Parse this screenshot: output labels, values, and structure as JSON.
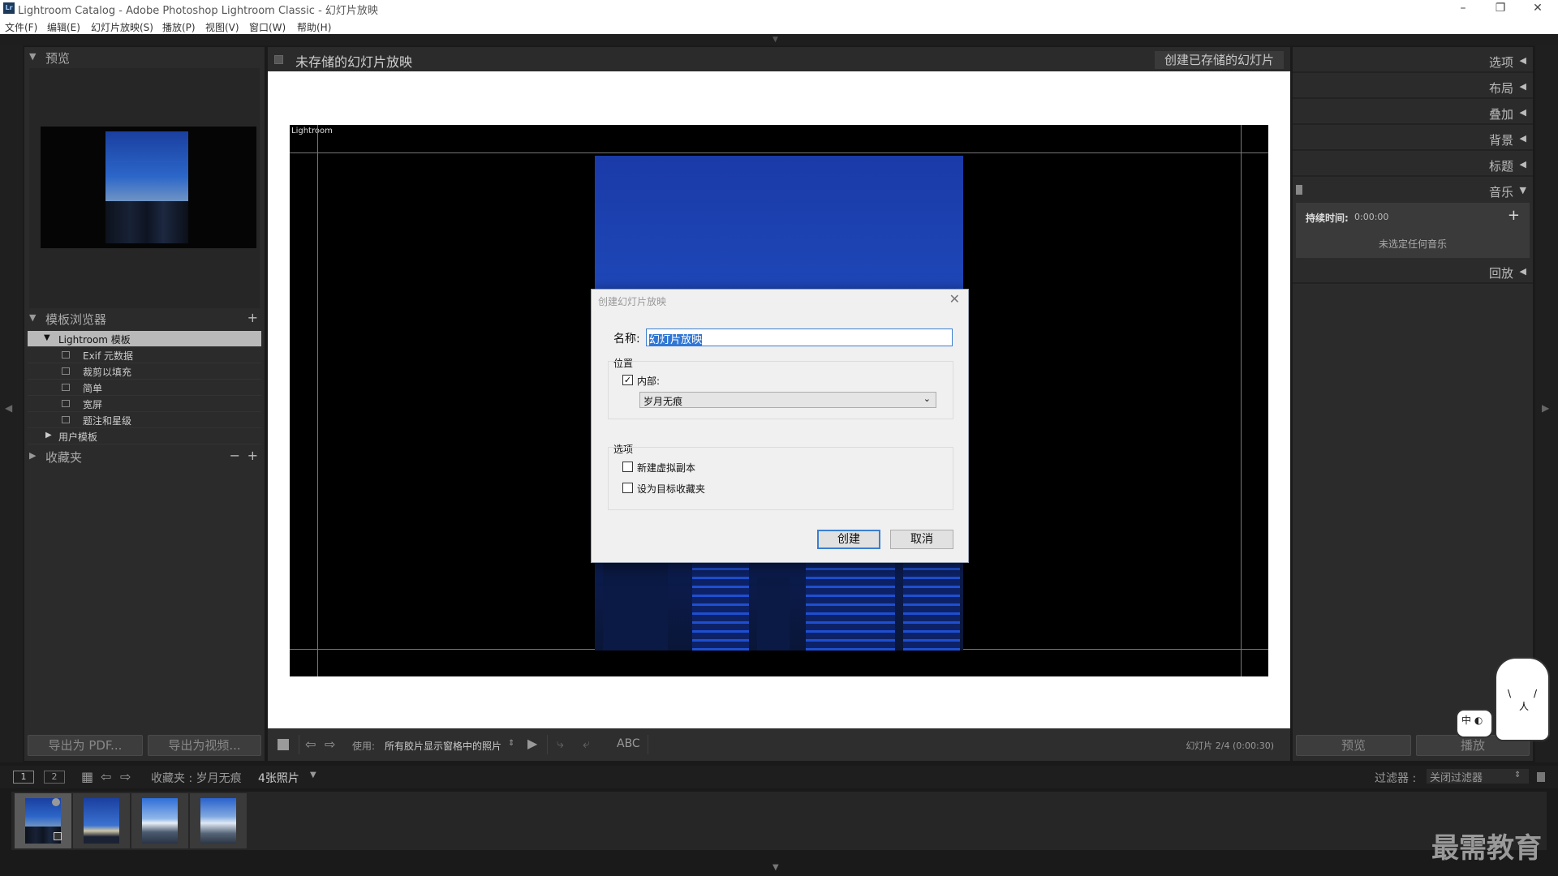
{
  "window": {
    "title": "Lightroom Catalog - Adobe Photoshop Lightroom Classic - 幻灯片放映",
    "logo_text": "Lr"
  },
  "menu": [
    "文件(F)",
    "编辑(E)",
    "幻灯片放映(S)",
    "播放(P)",
    "视图(V)",
    "窗口(W)",
    "帮助(H)"
  ],
  "left_panel": {
    "preview_header": "预览",
    "template_header": "模板浏览器",
    "lightroom_folder": "Lightroom 模板",
    "templates": [
      "Exif 元数据",
      "裁剪以填充",
      "简单",
      "宽屏",
      "题注和星级"
    ],
    "user_folder": "用户模板",
    "collections_header": "收藏夹",
    "export_pdf": "导出为 PDF...",
    "export_video": "导出为视频..."
  },
  "center": {
    "slideshow_name": "未存储的幻灯片放映",
    "save_button": "创建已存储的幻灯片",
    "identity_plate": "Lightroom",
    "use_label": "使用:",
    "use_value": "所有胶片显示窗格中的照片",
    "abc_label": "ABC",
    "slide_info": "幻灯片 2/4 (0:00:30)"
  },
  "right_panel": {
    "sections": [
      "选项",
      "布局",
      "叠加",
      "背景",
      "标题",
      "音乐",
      "回放"
    ],
    "music": {
      "duration_label": "持续时间:",
      "duration_value": "0:00:00",
      "no_music": "未选定任何音乐"
    },
    "preview_button": "预览",
    "play_button": "播放"
  },
  "filmstrip": {
    "page1": "1",
    "page2": "2",
    "collection_path": "收藏夹 : 岁月无痕",
    "photo_count": "4张照片",
    "filter_label": "过滤器 :",
    "filter_value": "关闭过滤器"
  },
  "dialog": {
    "title": "创建幻灯片放映",
    "name_label": "名称:",
    "name_value": "幻灯片放映",
    "location_label": "位置",
    "inside_label": "内部:",
    "inside_checked": true,
    "inside_value": "岁月无痕",
    "options_label": "选项",
    "virtual_copy_label": "新建虚拟副本",
    "virtual_copy_checked": false,
    "target_label": "设为目标收藏夹",
    "target_checked": false,
    "create_button": "创建",
    "cancel_button": "取消"
  },
  "overlay": {
    "mascot_text": "中",
    "brand_watermark": "最需教育"
  }
}
